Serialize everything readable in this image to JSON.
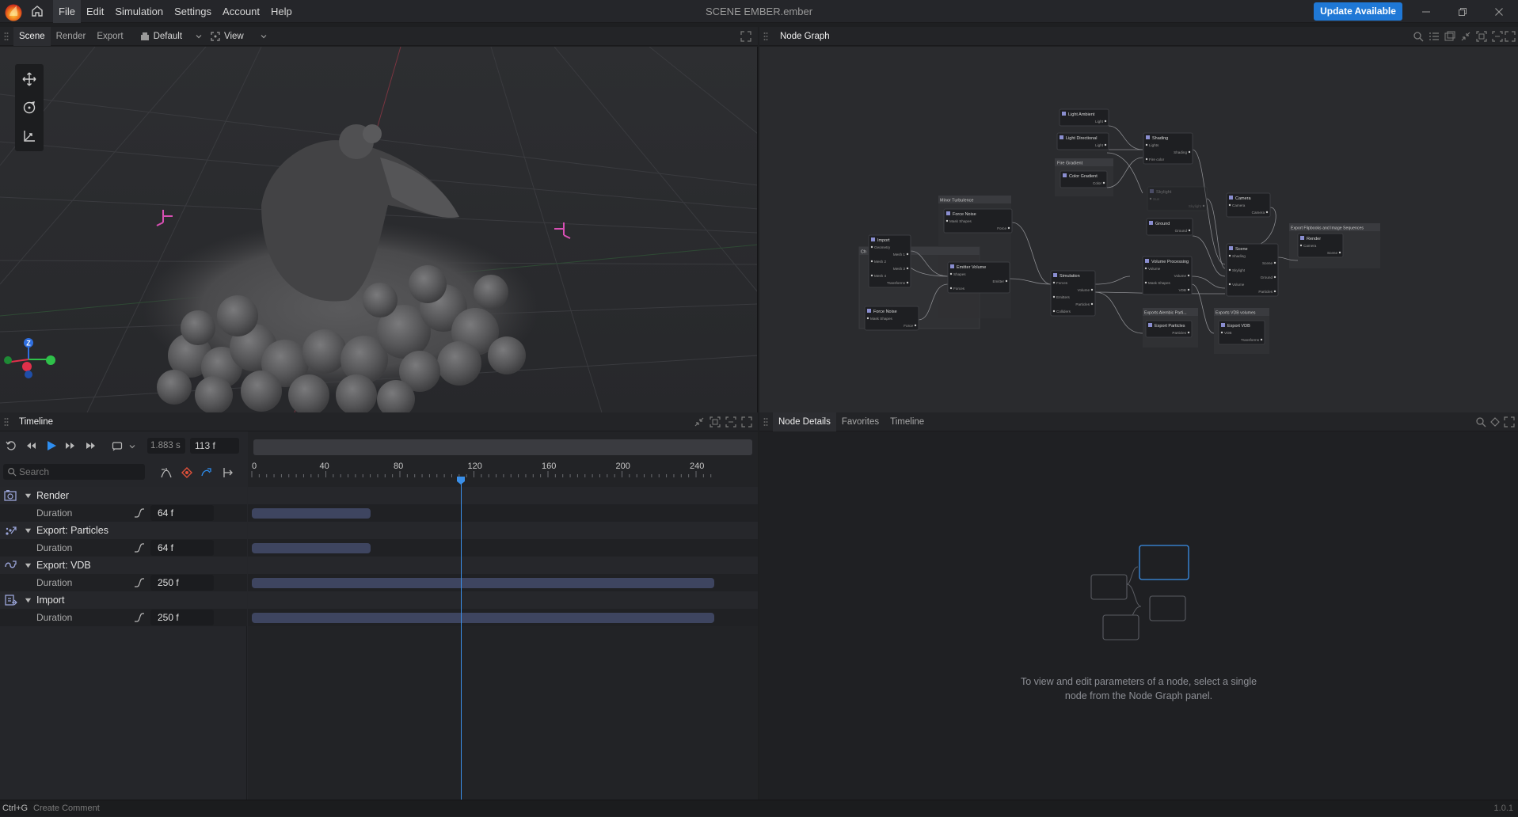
{
  "window": {
    "title": "SCENE EMBER.ember",
    "update_button": "Update Available",
    "menu": [
      "File",
      "Edit",
      "Simulation",
      "Settings",
      "Account",
      "Help"
    ]
  },
  "left_top": {
    "tabs": [
      "Scene",
      "Render",
      "Export"
    ],
    "active_tab": "Scene",
    "layout_dropdown": "Default",
    "view_dropdown": "View"
  },
  "right_top": {
    "title": "Node Graph"
  },
  "node_graph": {
    "groups": [
      "Minor Turbulence",
      "Fire Gradient",
      "Exports Alembic Parti...",
      "Exports VDB volumes",
      "Export Flipbooks and Image Sequences",
      "Ch"
    ],
    "nodes": [
      {
        "title": "Light Ambient",
        "ports": [
          "Light"
        ]
      },
      {
        "title": "Light Directional",
        "ports": [
          "Light"
        ]
      },
      {
        "title": "Color Gradient",
        "ports": [
          "Color"
        ]
      },
      {
        "title": "Force Noise",
        "ports": [
          "Mask Shapes",
          "Force"
        ]
      },
      {
        "title": "Import",
        "ports": [
          "Geometry",
          "Mesh 1",
          "Mesh 2",
          "Mesh 3",
          "Mesh 4",
          "Transforms"
        ]
      },
      {
        "title": "Emitter Volume",
        "ports": [
          "Shapes",
          "Emitter",
          "Forces"
        ]
      },
      {
        "title": "Force Noise",
        "ports": [
          "Mask Shapes",
          "Force"
        ]
      },
      {
        "title": "Shading",
        "ports": [
          "Lights",
          "Shading",
          "Fire color"
        ]
      },
      {
        "title": "Skylight",
        "ports": [
          "Sun",
          "Skylight"
        ]
      },
      {
        "title": "Ground",
        "ports": [
          "Ground"
        ]
      },
      {
        "title": "Simulation",
        "ports": [
          "Forces",
          "Volume",
          "Emitters",
          "Particles",
          "Colliders"
        ]
      },
      {
        "title": "Volume Processing",
        "ports": [
          "Volume",
          "Volume",
          "Mask Shapes",
          "VDB"
        ]
      },
      {
        "title": "Export Particles",
        "ports": [
          "Particles"
        ]
      },
      {
        "title": "Camera",
        "ports": [
          "Camera",
          "Camera"
        ]
      },
      {
        "title": "Scene",
        "ports": [
          "Shading",
          "Scene",
          "Skylight",
          "Ground",
          "Volume",
          "Particles"
        ]
      },
      {
        "title": "Render",
        "ports": [
          "Camera",
          "Scene"
        ]
      },
      {
        "title": "Export VDB",
        "ports": [
          "VDB",
          "Transforms"
        ]
      }
    ]
  },
  "timeline": {
    "title": "Timeline",
    "time_seconds": "1.883 s",
    "frame": "113 f",
    "search_placeholder": "Search",
    "ruler_ticks": [
      "0",
      "40",
      "80",
      "120",
      "160",
      "200",
      "240"
    ],
    "playhead_frame": 113,
    "frames_per_40": 40,
    "tracks": [
      {
        "name": "Render",
        "param": "Duration",
        "value": "64 f",
        "frames": 64
      },
      {
        "name": "Export: Particles",
        "param": "Duration",
        "value": "64 f",
        "frames": 64
      },
      {
        "name": "Export: VDB",
        "param": "Duration",
        "value": "250 f",
        "frames": 250
      },
      {
        "name": "Import",
        "param": "Duration",
        "value": "250 f",
        "frames": 250
      }
    ]
  },
  "details": {
    "tabs": [
      "Node Details",
      "Favorites",
      "Timeline"
    ],
    "active_tab": "Node Details",
    "empty_line1": "To view and edit parameters of a node, select a single",
    "empty_line2": "node from the Node Graph panel."
  },
  "status": {
    "shortcut": "Ctrl+G",
    "hint": "Create Comment",
    "version": "1.0.1"
  },
  "colors": {
    "accent": "#1f78d6",
    "playhead": "#3a8fe8",
    "track_bar": "#3e4560",
    "axis_x": "#e0304a",
    "axis_y": "#2fc14a",
    "axis_z": "#2f6fe0"
  }
}
